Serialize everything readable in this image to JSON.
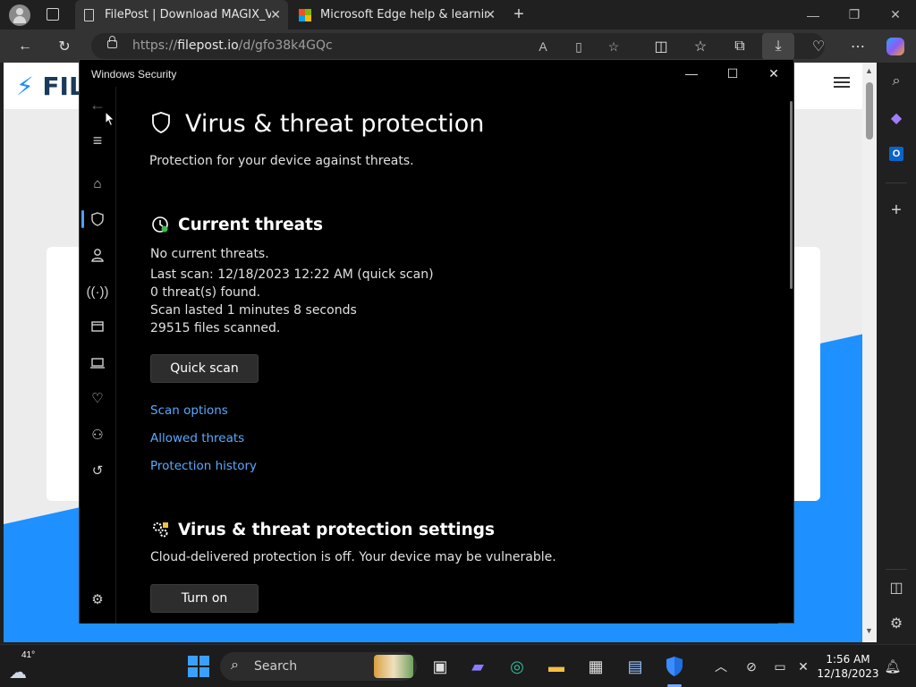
{
  "browser": {
    "tabs": [
      {
        "label": "FilePost | Download MAGIX_Vega",
        "active": true
      },
      {
        "label": "Microsoft Edge help & learning",
        "active": false
      }
    ],
    "url_prefix": "https://",
    "url_host": "filepost.io",
    "url_path": "/d/gfo38k4GQc",
    "page_logo": "FIL"
  },
  "security_window": {
    "title": "Windows Security",
    "page_title": "Virus & threat protection",
    "page_subtitle": "Protection for your device against threats.",
    "current_threats": {
      "heading": "Current threats",
      "lines": [
        "No current threats.",
        "Last scan: 12/18/2023 12:22 AM (quick scan)",
        "0 threat(s) found.",
        "Scan lasted 1 minutes 8 seconds",
        "29515 files scanned."
      ],
      "quick_scan_label": "Quick scan",
      "links": [
        "Scan options",
        "Allowed threats",
        "Protection history"
      ]
    },
    "settings": {
      "heading": "Virus & threat protection settings",
      "message": "Cloud-delivered protection is off. Your device may be vulnerable.",
      "turn_on_label": "Turn on"
    },
    "nav_icons": [
      "back-arrow-icon",
      "hamburger-icon",
      "home-icon",
      "shield-icon",
      "account-icon",
      "wifi-icon",
      "app-browser-icon",
      "laptop-icon",
      "heart-pulse-icon",
      "family-icon",
      "history-icon",
      "settings-gear-icon"
    ]
  },
  "taskbar": {
    "weather_temp": "41°",
    "search_label": "Search",
    "time": "1:56 AM",
    "date": "12/18/2023"
  },
  "colors": {
    "link": "#5aa9ff",
    "nav_selected": "#4ca0ff",
    "page_blue": "#1e90ff"
  }
}
